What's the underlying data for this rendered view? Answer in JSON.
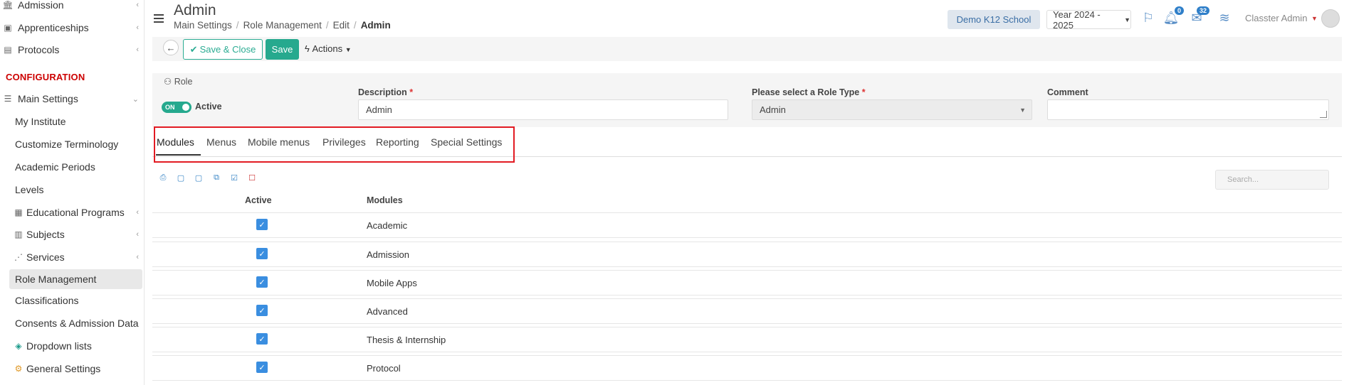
{
  "sidebar": {
    "items": [
      {
        "label": "Admission",
        "icon": "bank-icon"
      },
      {
        "label": "Apprenticeships",
        "icon": "box-icon"
      },
      {
        "label": "Protocols",
        "icon": "clipboard-icon"
      }
    ],
    "section_title": "CONFIGURATION",
    "main_settings": "Main Settings",
    "sub_items": [
      {
        "label": "My Institute"
      },
      {
        "label": "Customize Terminology"
      },
      {
        "label": "Academic Periods"
      },
      {
        "label": "Levels"
      },
      {
        "label": "Educational Programs",
        "icon": "table-icon"
      },
      {
        "label": "Subjects",
        "icon": "book-icon"
      },
      {
        "label": "Services",
        "icon": "network-icon"
      },
      {
        "label": "Role Management"
      },
      {
        "label": "Classifications"
      },
      {
        "label": "Consents & Admission Data"
      },
      {
        "label": "Dropdown lists",
        "icon": "layers-icon"
      },
      {
        "label": "General Settings",
        "icon": "gear-icon"
      }
    ]
  },
  "header": {
    "title": "Admin",
    "breadcrumb": [
      "Main Settings",
      "Role Management",
      "Edit",
      "Admin"
    ],
    "school": "Demo K12 School",
    "year": "Year 2024 - 2025",
    "notifications_count": "0",
    "messages_count": "32",
    "user": "Classter Admin"
  },
  "toolbar": {
    "save_close_label": "Save & Close",
    "save_label": "Save",
    "actions_label": "Actions"
  },
  "form": {
    "role_label": "Role",
    "toggle_label": "ON",
    "active_label": "Active",
    "description_label": "Description",
    "description_value": "Admin",
    "role_type_label": "Please select a Role Type",
    "role_type_value": "Admin",
    "comment_label": "Comment",
    "comment_value": ""
  },
  "tabs": [
    "Modules",
    "Menus",
    "Mobile menus",
    "Privileges",
    "Reporting",
    "Special Settings"
  ],
  "search_placeholder": "Search...",
  "table": {
    "headers": {
      "active": "Active",
      "modules": "Modules"
    },
    "rows": [
      {
        "module": "Academic",
        "active": true
      },
      {
        "module": "Admission",
        "active": true
      },
      {
        "module": "Mobile Apps",
        "active": true
      },
      {
        "module": "Advanced",
        "active": true
      },
      {
        "module": "Thesis & Internship",
        "active": true
      },
      {
        "module": "Protocol",
        "active": true
      }
    ]
  },
  "colors": {
    "accent": "#26a98e",
    "highlight": "#e21b23",
    "checkbox": "#3a8ee0",
    "section": "#cc0000"
  }
}
